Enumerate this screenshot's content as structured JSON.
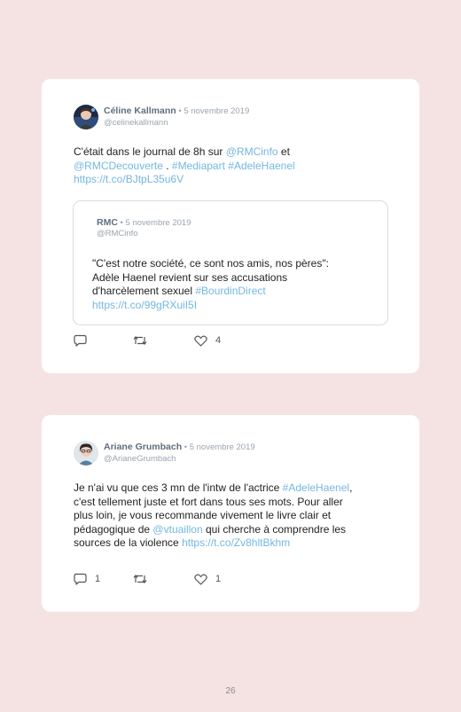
{
  "tweets": [
    {
      "author": "Céline Kallmann",
      "separator": " • ",
      "date": "5 novembre 2019",
      "handle": "@celinekallmann",
      "text": {
        "t1": "C'était dans le journal de 8h sur ",
        "m1": "@RMCinfo",
        "t2": " et",
        "m2": "@RMCDecouverte",
        "t3": " . ",
        "h1": "#Mediapart",
        "t4": " ",
        "h2": "#AdeleHaenel",
        "url": "https://t.co/BJtpL35u6V"
      },
      "quote": {
        "author": "RMC",
        "separator": " • ",
        "date": "5 novembre 2019",
        "handle": "@RMCinfo",
        "line1": "\"C'est notre société, ce sont nos amis, nos pères\":",
        "line2": "Adèle Haenel revient sur ses accusations",
        "line3": "d'harcèlement sexuel ",
        "hashtag": "#BourdinDirect",
        "url": "https://t.co/99gRXuiI5I"
      },
      "actions": {
        "replies": "",
        "retweets": "",
        "likes": "4"
      }
    },
    {
      "author": "Ariane Grumbach",
      "separator": " • ",
      "date": "5 novembre 2019",
      "handle": "@ArianeGrumbach",
      "text": {
        "l1a": "Je n'ai vu que ces 3 mn de l'intw de l'actrice ",
        "l1h": "#AdeleHaenel",
        "l1b": ",",
        "l2": "c'est tellement juste et fort dans tous ses mots. Pour aller",
        "l3": "plus loin, je vous recommande vivement le livre clair et",
        "l4a": "pédagogique de ",
        "l4m": "@vtuaillon",
        "l4b": " qui cherche à comprendre les",
        "l5a": "sources de la violence ",
        "l5u": "https://t.co/Zv8hltBkhm"
      },
      "actions": {
        "replies": "1",
        "retweets": "",
        "likes": "1"
      }
    }
  ],
  "page_number": "26",
  "colors": {
    "background": "#f5e3e4",
    "card": "#ffffff",
    "link": "#74b7e0",
    "name": "#5f6f7e",
    "muted": "#9aa4ad"
  },
  "icons": [
    "reply-icon",
    "retweet-icon",
    "like-icon"
  ]
}
